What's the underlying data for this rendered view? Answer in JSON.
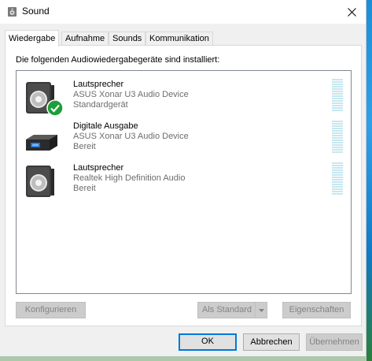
{
  "window": {
    "title": "Sound"
  },
  "tabs": [
    {
      "label": "Wiedergabe",
      "active": true
    },
    {
      "label": "Aufnahme",
      "active": false
    },
    {
      "label": "Sounds",
      "active": false
    },
    {
      "label": "Kommunikation",
      "active": false
    }
  ],
  "panel": {
    "heading": "Die folgenden Audiowiedergabegeräte sind installiert:"
  },
  "devices": [
    {
      "name": "Lautsprecher",
      "description": "ASUS Xonar U3 Audio Device",
      "status": "Standardgerät",
      "icon": "speaker-icon",
      "is_default": true
    },
    {
      "name": "Digitale Ausgabe",
      "description": "ASUS Xonar U3 Audio Device",
      "status": "Bereit",
      "icon": "digital-output-icon",
      "is_default": false
    },
    {
      "name": "Lautsprecher",
      "description": "Realtek High Definition Audio",
      "status": "Bereit",
      "icon": "speaker-icon",
      "is_default": false
    }
  ],
  "panel_buttons": {
    "configure": "Konfigurieren",
    "set_default": "Als Standard",
    "properties": "Eigenschaften"
  },
  "dialog_buttons": {
    "ok": "OK",
    "cancel": "Abbrechen",
    "apply": "Übernehmen"
  },
  "colors": {
    "accent": "#0078d7",
    "default_check": "#1e9e3a",
    "level_meter": "#c7e7f0"
  }
}
